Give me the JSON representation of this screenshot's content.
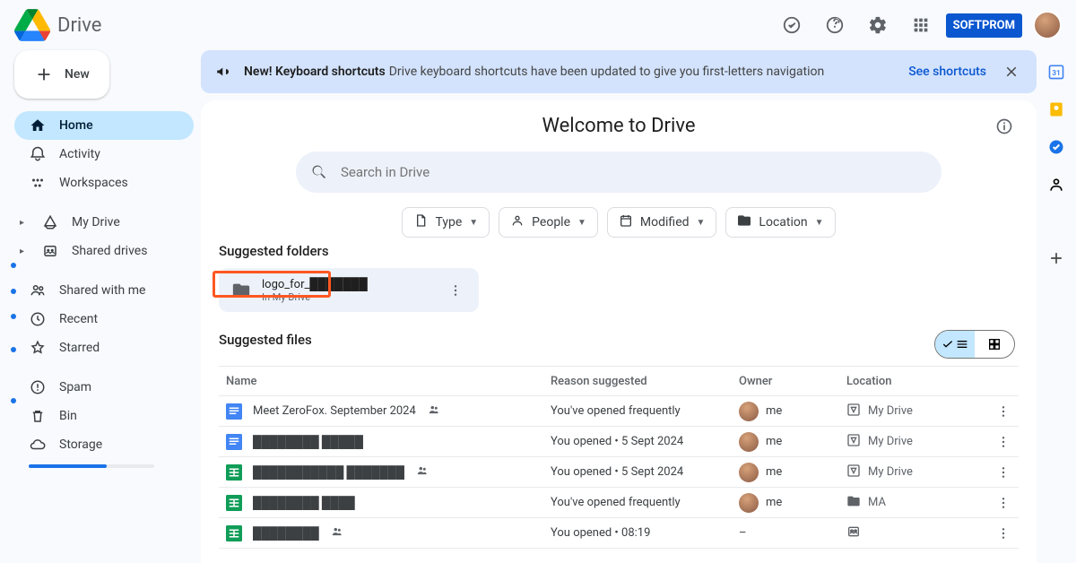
{
  "app": {
    "name": "Drive"
  },
  "header": {
    "brand_chip": "SOFTPROM"
  },
  "new_button": {
    "label": "New"
  },
  "sidebar": {
    "items": [
      {
        "label": "Home",
        "active": true
      },
      {
        "label": "Activity"
      },
      {
        "label": "Workspaces"
      }
    ],
    "items2": [
      {
        "label": "My Drive"
      },
      {
        "label": "Shared drives"
      }
    ],
    "items3": [
      {
        "label": "Shared with me"
      },
      {
        "label": "Recent"
      },
      {
        "label": "Starred"
      }
    ],
    "items4": [
      {
        "label": "Spam"
      },
      {
        "label": "Bin"
      },
      {
        "label": "Storage"
      }
    ]
  },
  "banner": {
    "bold": "New! Keyboard shortcuts",
    "text": "Drive keyboard shortcuts have been updated to give you first-letters navigation",
    "link": "See shortcuts"
  },
  "page": {
    "title": "Welcome to Drive"
  },
  "search": {
    "placeholder": "Search in Drive"
  },
  "chips": {
    "type": "Type",
    "people": "People",
    "modified": "Modified",
    "location": "Location"
  },
  "sections": {
    "suggested_folders": "Suggested folders",
    "suggested_files": "Suggested files"
  },
  "folder_card": {
    "name": "logo_for_███████",
    "loc": "In My Drive"
  },
  "table": {
    "headers": {
      "name": "Name",
      "reason": "Reason suggested",
      "owner": "Owner",
      "location": "Location"
    },
    "rows": [
      {
        "icon": "docs",
        "name": "Meet ZeroFox. September 2024",
        "shared": true,
        "reason": "You've opened frequently",
        "owner": "me",
        "loc": "My Drive",
        "loc_icon": "drive"
      },
      {
        "icon": "docs",
        "name": "████████ █████",
        "shared": false,
        "reason": "You opened • 5 Sept 2024",
        "owner": "me",
        "loc": "My Drive",
        "loc_icon": "drive"
      },
      {
        "icon": "sheets",
        "name": "███████████ ███████",
        "shared": true,
        "reason": "You opened • 5 Sept 2024",
        "owner": "me",
        "loc": "My Drive",
        "loc_icon": "drive"
      },
      {
        "icon": "sheets",
        "name": "████████ ████",
        "shared": false,
        "reason": "You've opened frequently",
        "owner": "me",
        "loc": "MA",
        "loc_icon": "folder-pink"
      },
      {
        "icon": "sheets",
        "name": "████████",
        "shared": true,
        "reason": "You opened • 08:19",
        "owner": "–",
        "loc": "",
        "loc_icon": "shared-drive"
      }
    ]
  }
}
